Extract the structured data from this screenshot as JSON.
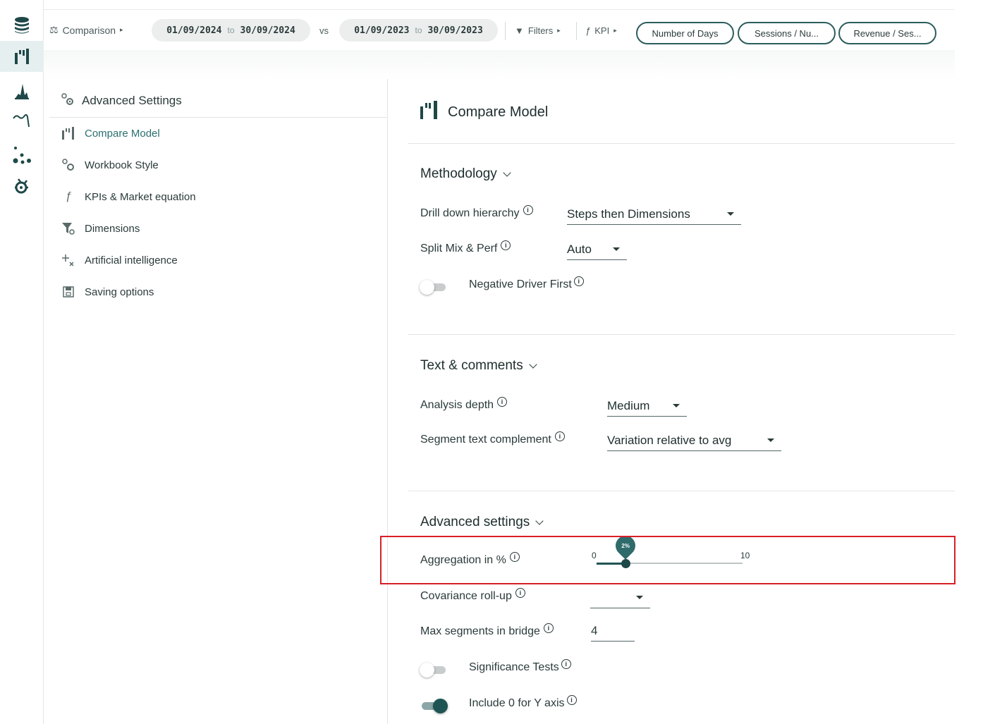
{
  "rail": {
    "items": [
      {
        "name": "database-icon"
      },
      {
        "name": "compare-model-icon",
        "active": true
      },
      {
        "name": "histogram-icon"
      },
      {
        "name": "trend-icon"
      },
      {
        "name": "scatter-icon"
      },
      {
        "name": "settings-gear-icon"
      }
    ]
  },
  "topbar": {
    "mode_label": "Comparison",
    "period1": {
      "from": "01/09/2024",
      "to_word": "to",
      "to": "30/09/2024"
    },
    "vs_label": "vs",
    "period2": {
      "from": "01/09/2023",
      "to_word": "to",
      "to": "30/09/2023"
    },
    "filters_label": "Filters",
    "kpi_label": "KPI",
    "kpi_pills": [
      "Number of Days",
      "Sessions / Nu...",
      "Revenue / Ses..."
    ]
  },
  "nav": {
    "title": "Advanced Settings",
    "items": [
      {
        "label": "Compare Model",
        "icon": "compare-model-icon",
        "active": true
      },
      {
        "label": "Workbook Style",
        "icon": "gears-icon"
      },
      {
        "label": "KPIs & Market equation",
        "icon": "function-icon"
      },
      {
        "label": "Dimensions",
        "icon": "filter-gear-icon"
      },
      {
        "label": "Artificial intelligence",
        "icon": "sparkle-icon"
      },
      {
        "label": "Saving options",
        "icon": "save-icon"
      }
    ]
  },
  "content": {
    "title": "Compare Model",
    "methodology": {
      "title": "Methodology",
      "drill_down_label": "Drill down hierarchy",
      "drill_down_value": "Steps then Dimensions",
      "split_label": "Split Mix & Perf",
      "split_value": "Auto",
      "negative_driver_label": "Negative Driver First",
      "negative_driver_on": false
    },
    "text_comments": {
      "title": "Text & comments",
      "analysis_depth_label": "Analysis depth",
      "analysis_depth_value": "Medium",
      "segment_text_label": "Segment text complement",
      "segment_text_value": "Variation relative to avg"
    },
    "advanced": {
      "title": "Advanced settings",
      "aggregation_label": "Aggregation in %",
      "aggregation_value": 2,
      "aggregation_bubble": "2%",
      "aggregation_min": "0",
      "aggregation_max": "10",
      "covariance_label": "Covariance roll-up",
      "covariance_value": "",
      "max_segments_label": "Max segments in bridge",
      "max_segments_value": "4",
      "significance_label": "Significance Tests",
      "significance_on": false,
      "include_zero_label": "Include 0 for Y axis",
      "include_zero_on": true
    }
  },
  "colors": {
    "accent": "#1f5454",
    "highlight": "#d81f26"
  }
}
